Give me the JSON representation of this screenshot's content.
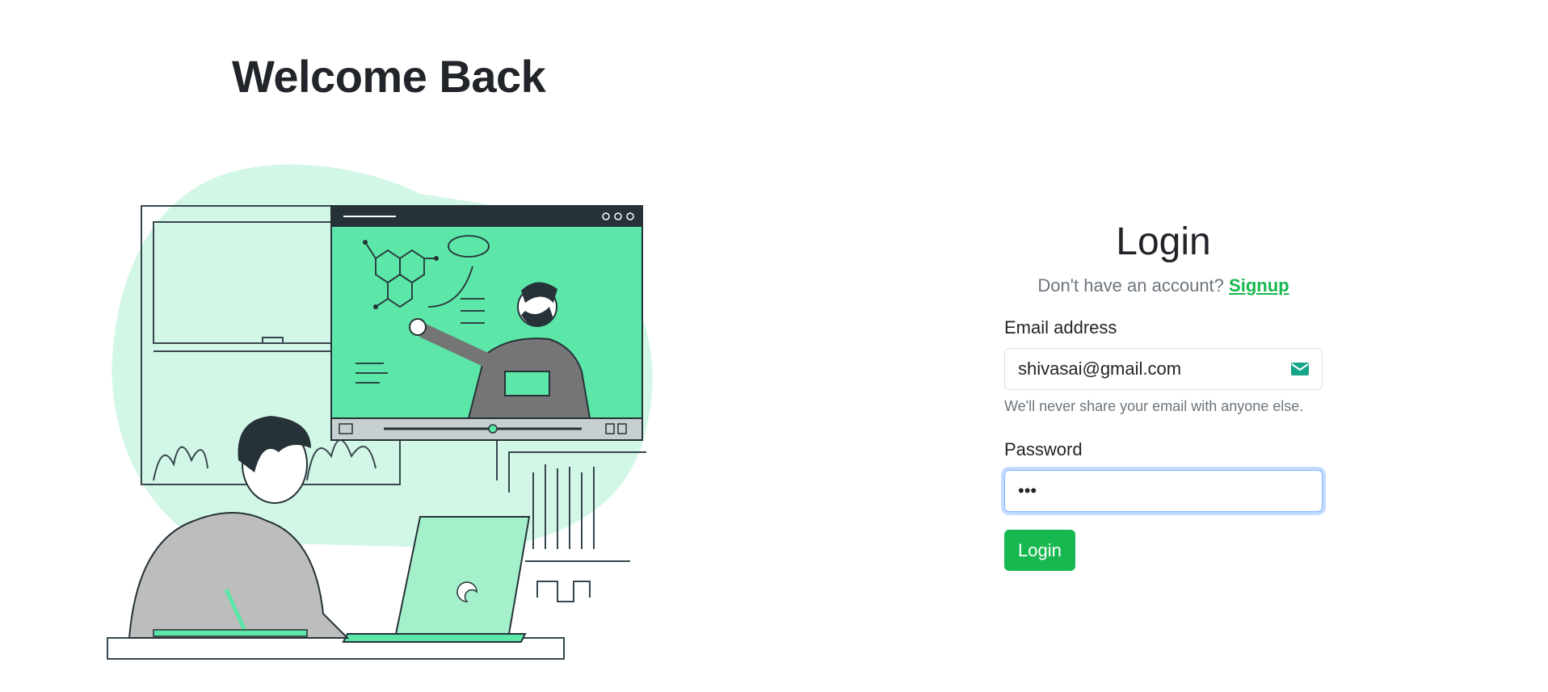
{
  "welcome": {
    "title": "Welcome Back"
  },
  "login": {
    "title": "Login",
    "signup_prompt": "Don't have an account?",
    "signup_link": "Signup",
    "email": {
      "label": "Email address",
      "value": "shivasai@gmail.com",
      "icon": "envelope-icon",
      "help": "We'll never share your email with anyone else."
    },
    "password": {
      "label": "Password",
      "value": "•••"
    },
    "submit_label": "Login"
  },
  "colors": {
    "brand_green": "#17b84f",
    "illustration_mint": "#5ce6a8",
    "illustration_bg": "#d3f7e6",
    "dark": "#263238"
  }
}
